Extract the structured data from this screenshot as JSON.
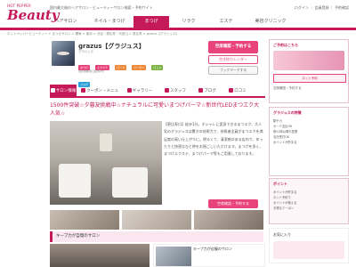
{
  "header": {
    "logo_small": "HOT PEPPER",
    "logo": "Beauty",
    "tagline": "国内最大級のヘアサロン・ビューティーサロン検索・予約サイト",
    "links": "ログイン ｜ 会員登録 ｜ 予約確認",
    "nav": [
      "ヘアサロン",
      "ネイル・まつげ",
      "まつげ",
      "リラク",
      "エステ",
      "美容クリニック"
    ],
    "nav_active_index": 2,
    "breadcrumb": "ホットペッパービューティー > まつげサロン > 関東 > 東京 > 渋谷・恵比寿・代官山 > 恵比寿 > grazus【グラジュス】"
  },
  "salon": {
    "name": "grazus【グラジュス】",
    "kana": "グラジュス",
    "tags": [
      {
        "label": "まつげ",
        "color": "#e8437a"
      },
      {
        "label": "エクステ",
        "color": "#e8437a"
      },
      {
        "label": "パーマ",
        "color": "#f08a3c"
      },
      {
        "label": "クーポン",
        "color": "#f08a3c"
      },
      {
        "label": "口コミ",
        "color": "#7cb342"
      },
      {
        "label": "ブログ",
        "color": "#29a0d8"
      }
    ],
    "desc": "恵比寿駅東口徒歩2分",
    "reserve_label": "空席確認・予約する",
    "reserve_sub": "ネット予約",
    "check_label": "空き枠カレンダー",
    "bookmark_label": "ブックマークする"
  },
  "tabs": [
    {
      "label": "サロン情報",
      "icon": "home-icon"
    },
    {
      "label": "クーポン・メニュー",
      "icon": "coupon-icon"
    },
    {
      "label": "ギャラリー",
      "icon": "camera-icon"
    },
    {
      "label": "スタッフ",
      "icon": "person-icon"
    },
    {
      "label": "ブログ",
      "icon": "pen-icon"
    },
    {
      "label": "口コミ",
      "icon": "speech-icon"
    }
  ],
  "active_tab_index": 0,
  "main": {
    "catch": "1500件突破☆夕暮友挑戦中☆ナチュラルに可愛いまつげパーマ☆新世代LEDまつエク大人気☆",
    "intro": "【恵比寿口】徒歩1分。オシャレに変身できるまつエク、大人気のグラジュスは驚きの技術力で、技術者全員がまつエクを満足度の高い仕上がりに。明るくて、清潔感のある店内で、ゆったりと快適なひと時をお過ごしいただけます。まつげを多く、まつげエクステ、まつげパーマ等もご用意しております。",
    "reserve_label": "空席確認・予約する",
    "section2_title": "キープ力が自慢のサロン",
    "card2_title": "キープ力が自慢のサロン"
  },
  "sidebar": {
    "ad_title": "ご予約はこちら",
    "ad_label": "ネット予約",
    "ad_link": "空席確認・予約する",
    "info_title": "グラジュスの特徴",
    "info_rows": [
      "駅チカ",
      "カード支払OK",
      "夜21時以降も営業",
      "当日受付OK",
      "ポイントが貯まる"
    ],
    "tips_title": "ポイント",
    "tips_rows": [
      "ポイントが貯まる",
      "ネット予約で",
      "ポイントが使える",
      "お得なクーポン"
    ],
    "stamp_title": "お気に入り"
  }
}
